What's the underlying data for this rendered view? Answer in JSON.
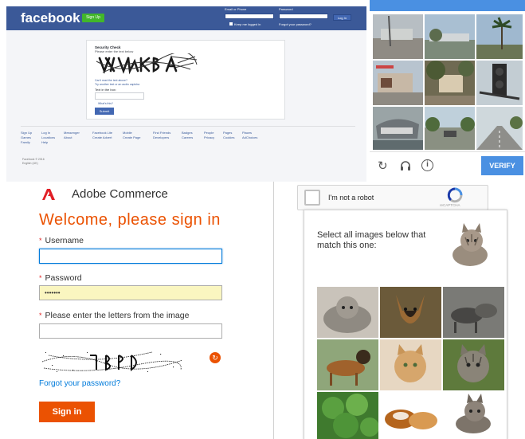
{
  "facebook": {
    "logo": "facebook",
    "signup_label": "Sign Up",
    "email_label": "Email or Phone",
    "password_label": "Password",
    "login_label": "Log In",
    "keep_logged_in": "Keep me logged in",
    "forgot_account": "Forgot your password?",
    "security_check_title": "Security Check",
    "security_check_sub": "Please enter the text below",
    "cant_read": "Can't read the text above?",
    "try_another": "Try another text or an audio captcha",
    "text_in_box_label": "Text in the box:",
    "whats_this": "What's this?",
    "submit_label": "Submit",
    "footer_links": [
      [
        "Sign Up",
        "Games"
      ],
      [
        "Log In",
        "Locations"
      ],
      [
        "Messenger",
        "About"
      ],
      [
        "Facebook Lite",
        "Create Advert"
      ],
      [
        "Mobile",
        "Create Page"
      ],
      [
        "Find Friends",
        "Developers"
      ],
      [
        "Badges",
        "Careers"
      ],
      [
        "People",
        "Privacy"
      ],
      [
        "Pages",
        "Cookies"
      ],
      [
        "Places",
        "AdChoices"
      ]
    ],
    "footer_extra": [
      "Family",
      "Help"
    ],
    "copyright": "Facebook © 2016",
    "language": "English (UK)"
  },
  "recaptcha_grid": {
    "verify_label": "VERIFY",
    "reload_icon": "reload-icon",
    "audio_icon": "headphones-icon",
    "info_icon": "info-icon"
  },
  "adobe": {
    "brand": "Adobe Commerce",
    "welcome": "Welcome, please sign in",
    "username_label": "Username",
    "password_label": "Password",
    "password_value": "•••••••",
    "captcha_label": "Please enter the letters from the image",
    "forgot_password": "Forgot your password?",
    "signin_label": "Sign in",
    "accent": "#eb5202"
  },
  "recaptcha_match": {
    "checkbox_label": "I'm not a robot",
    "brand": "reCAPTCHA",
    "prompt": "Select all images below that match this one:",
    "accent": "#4a90e2"
  }
}
